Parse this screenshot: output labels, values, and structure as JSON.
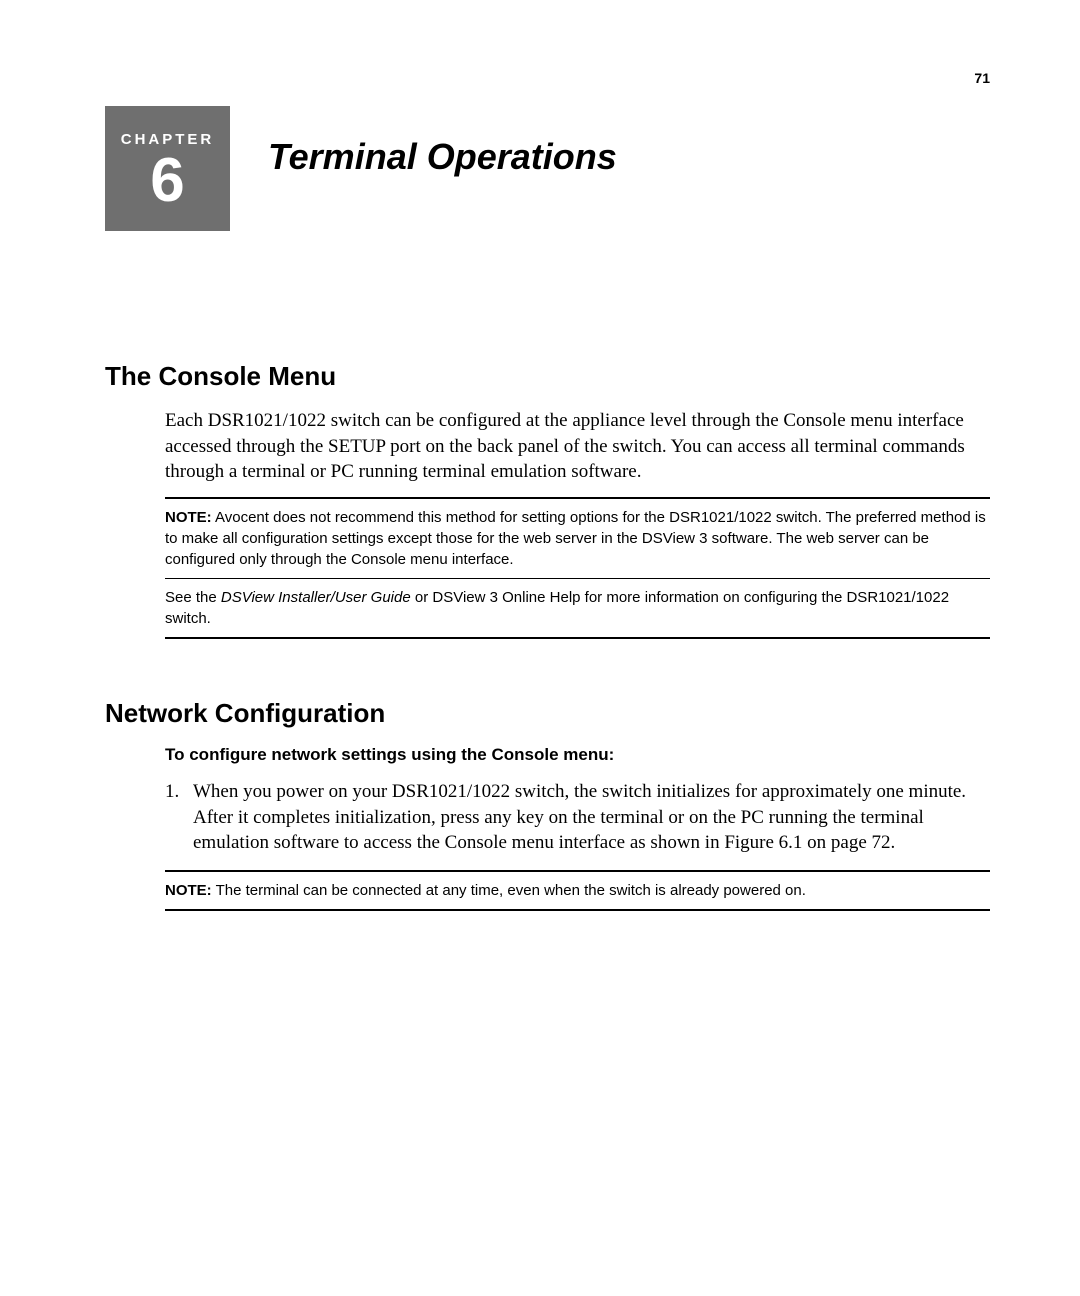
{
  "page_number": "71",
  "chapter": {
    "label": "CHAPTER",
    "number": "6",
    "title": "Terminal Operations"
  },
  "sections": {
    "console_menu": {
      "heading": "The Console Menu",
      "paragraph": "Each DSR1021/1022 switch can be configured at the appliance level through the Console menu interface accessed through the SETUP port on the back panel of the switch. You can access all terminal commands through a terminal or PC running terminal emulation software.",
      "note1_label": "NOTE:",
      "note1_text": " Avocent does not recommend this method for setting options for the DSR1021/1022 switch. The preferred method is to make all configuration settings except those for the web server in the DSView 3 software. The web server can be configured only through the Console menu interface.",
      "note2_pre": "See the ",
      "note2_italic": "DSView Installer/User Guide",
      "note2_post": " or DSView 3 Online Help for more information on configuring the DSR1021/1022 switch."
    },
    "network_config": {
      "heading": "Network Configuration",
      "sub_heading": "To configure network settings using the Console menu:",
      "step1_number": "1.",
      "step1_text": "When you power on your DSR1021/1022 switch, the switch initializes for approximately one minute. After it completes initialization, press any key on the terminal or on the PC running the terminal emulation software to access the Console menu interface as shown in Figure 6.1 on page 72.",
      "note_label": "NOTE:",
      "note_text": " The terminal can be connected at any time, even when the switch is already powered on."
    }
  }
}
